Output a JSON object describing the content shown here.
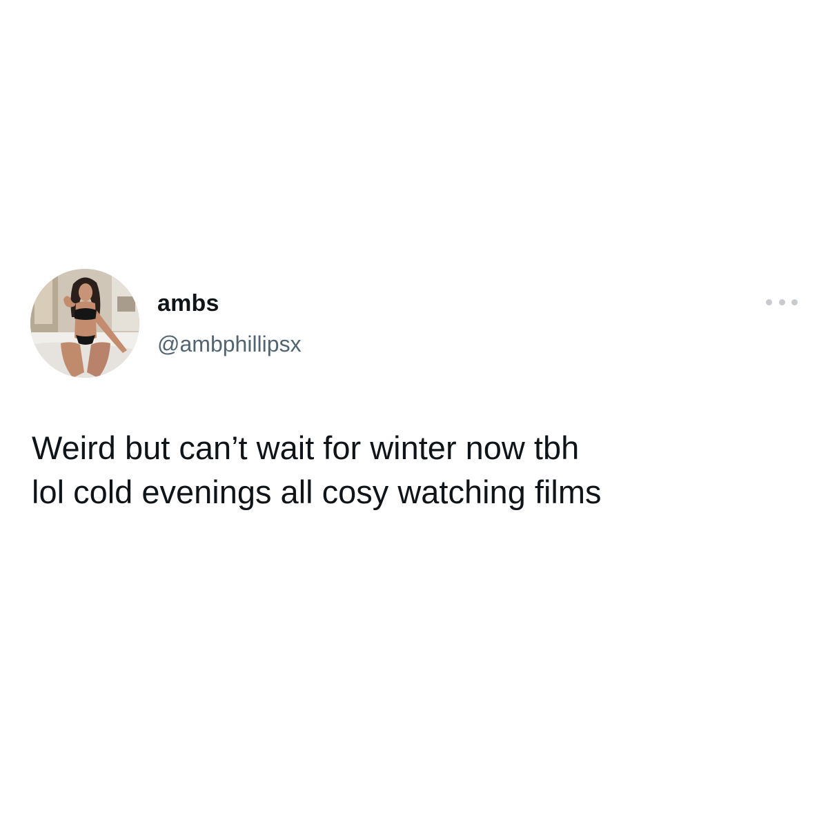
{
  "tweet": {
    "display_name": "ambs",
    "handle": "@ambphillipsx",
    "text_lines": [
      "Weird but can’t wait for winter now tbh",
      "lol cold evenings all cosy watching films"
    ],
    "more_icon": "more-horizontal-icon",
    "avatar_icon": "profile-photo"
  },
  "colors": {
    "background": "#ffffff",
    "text_primary": "#0f1419",
    "text_secondary": "#536471",
    "more_dots": "#c7cbcf"
  }
}
